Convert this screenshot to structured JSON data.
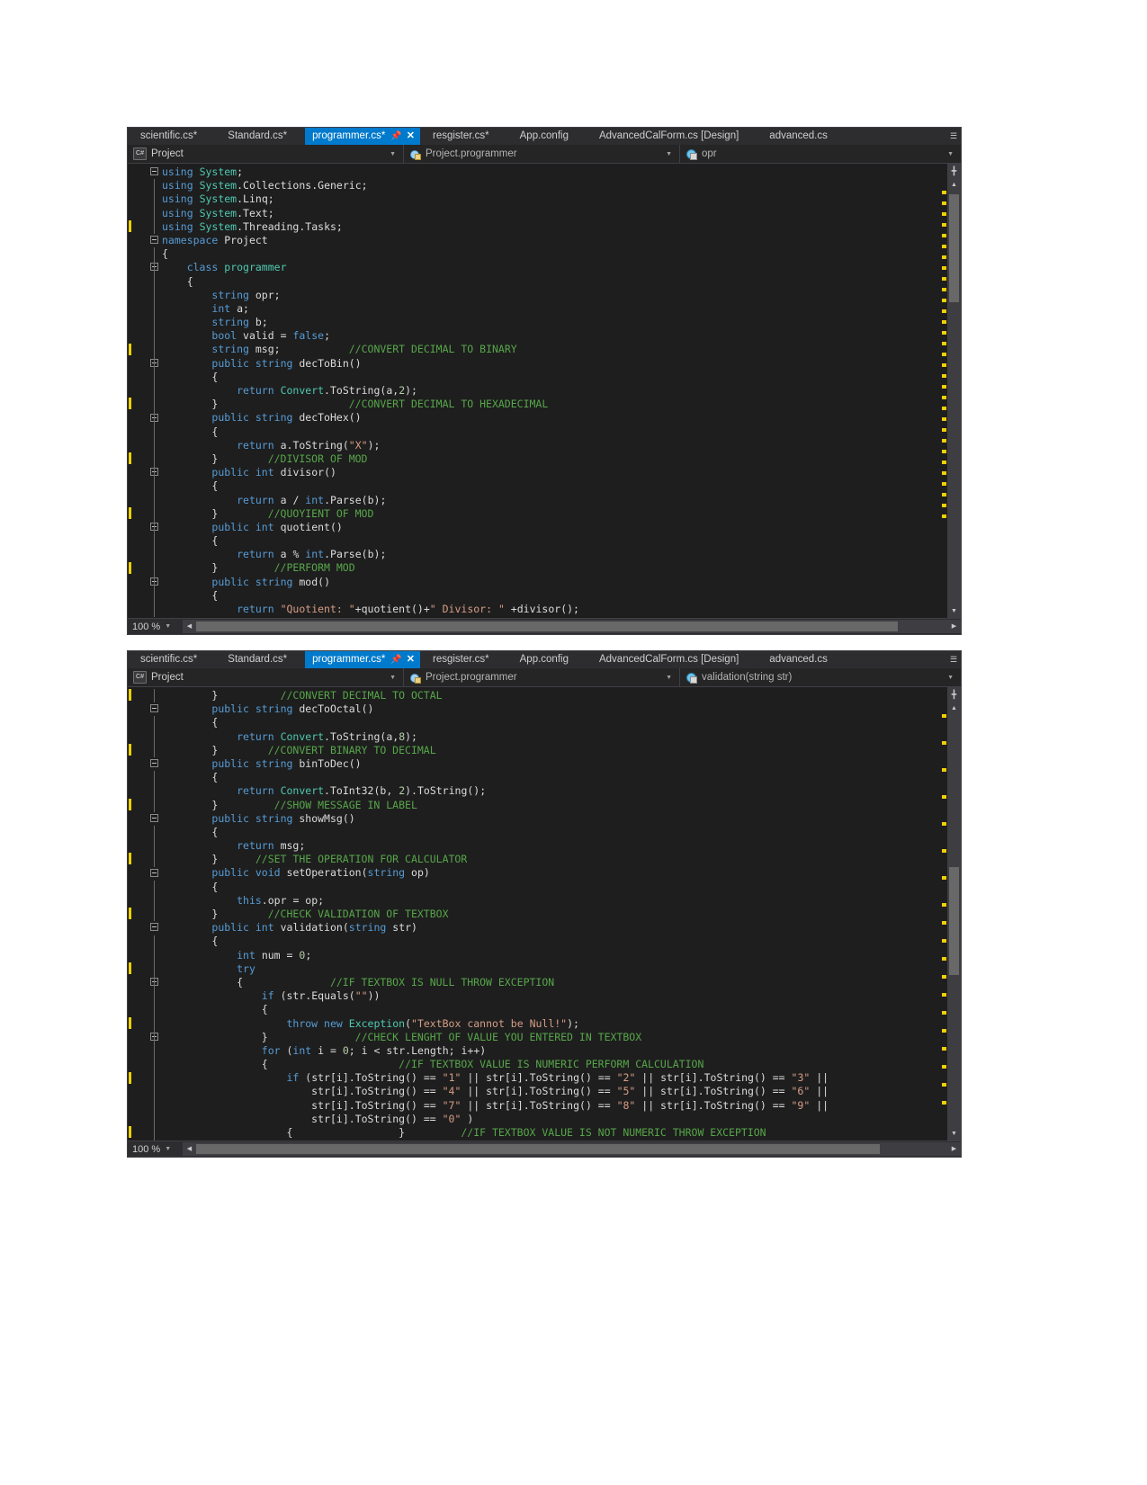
{
  "window": {
    "app": "Visual Studio Code Editor",
    "zoom_label": "100 %"
  },
  "tabs": [
    {
      "label": "scientific.cs*",
      "active": false
    },
    {
      "label": "Standard.cs*",
      "active": false
    },
    {
      "label": "programmer.cs*",
      "active": true,
      "pin_icon": "pin-icon",
      "close_icon": "close-icon"
    },
    {
      "label": "resgister.cs*",
      "active": false
    },
    {
      "label": "App.config",
      "active": false
    },
    {
      "label": "AdvancedCalForm.cs [Design]",
      "active": false
    },
    {
      "label": "advanced.cs",
      "active": false
    }
  ],
  "navbar_top": {
    "project": "Project",
    "project_icon": "csharp-file-icon",
    "type": "Project.programmer",
    "type_icon": "class-icon",
    "member": "opr",
    "member_icon": "field-icon"
  },
  "navbar_bottom": {
    "project": "Project",
    "project_icon": "csharp-file-icon",
    "type": "Project.programmer",
    "type_icon": "class-icon",
    "member": "validation(string str)",
    "member_icon": "method-icon"
  },
  "colors": {
    "accent": "#007acc",
    "editor_bg": "#1e1e1e",
    "chrome_bg": "#2d2d30",
    "keyword": "#569cd6",
    "type": "#4ec9b0",
    "comment": "#57a64a",
    "string": "#d69d85",
    "number": "#b5cea8",
    "text": "#dcdcdc",
    "change_mark": "#f0d000"
  },
  "code_top": [
    "using System;",
    "using System.Collections.Generic;",
    "using System.Linq;",
    "using System.Text;",
    "using System.Threading.Tasks;",
    "namespace Project",
    "{",
    "    class programmer",
    "    {",
    "        string opr;",
    "        int a;",
    "        string b;",
    "        bool valid = false;",
    "        string msg;           //CONVERT DECIMAL TO BINARY",
    "        public string decToBin()",
    "        {",
    "            return Convert.ToString(a,2);",
    "        }                     //CONVERT DECIMAL TO HEXADECIMAL",
    "        public string decToHex()",
    "        {",
    "            return a.ToString(\"X\");",
    "        }        //DIVISOR OF MOD",
    "        public int divisor()",
    "        {",
    "            return a / int.Parse(b);",
    "        }        //QUOYIENT OF MOD",
    "        public int quotient()",
    "        {",
    "            return a % int.Parse(b);",
    "        }         //PERFORM MOD",
    "        public string mod()",
    "        {",
    "            return \"Quotient: \"+quotient()+\" Divisor: \" +divisor();"
  ],
  "code_bottom": [
    "        }          //CONVERT DECIMAL TO OCTAL",
    "        public string decToOctal()",
    "        {",
    "            return Convert.ToString(a,8);",
    "        }        //CONVERT BINARY TO DECIMAL",
    "        public string binToDec()",
    "        {",
    "            return Convert.ToInt32(b, 2).ToString();",
    "        }         //SHOW MESSAGE IN LABEL",
    "        public string showMsg()",
    "        {",
    "            return msg;",
    "        }      //SET THE OPERATION FOR CALCULATOR",
    "        public void setOperation(string op)",
    "        {",
    "            this.opr = op;",
    "        }        //CHECK VALIDATION OF TEXTBOX",
    "        public int validation(string str)",
    "        {",
    "            int num = 0;",
    "            try",
    "            {              //IF TEXTBOX IS NULL THROW EXCEPTION",
    "                if (str.Equals(\"\"))",
    "                {",
    "                    throw new Exception(\"TextBox cannot be Null!\");",
    "                }              //CHECK LENGHT OF VALUE YOU ENTERED IN TEXTBOX",
    "                for (int i = 0; i < str.Length; i++)",
    "                {                     //IF TEXTBOX VALUE IS NUMERIC PERFORM CALCULATION",
    "                    if (str[i].ToString() == \"1\" || str[i].ToString() == \"2\" || str[i].ToString() == \"3\" ||",
    "                        str[i].ToString() == \"4\" || str[i].ToString() == \"5\" || str[i].ToString() == \"6\" ||",
    "                        str[i].ToString() == \"7\" || str[i].ToString() == \"8\" || str[i].ToString() == \"9\" ||",
    "                        str[i].ToString() == \"0\" )",
    "                    {                 }         //IF TEXTBOX VALUE IS NOT NUMERIC THROW EXCEPTION"
  ]
}
